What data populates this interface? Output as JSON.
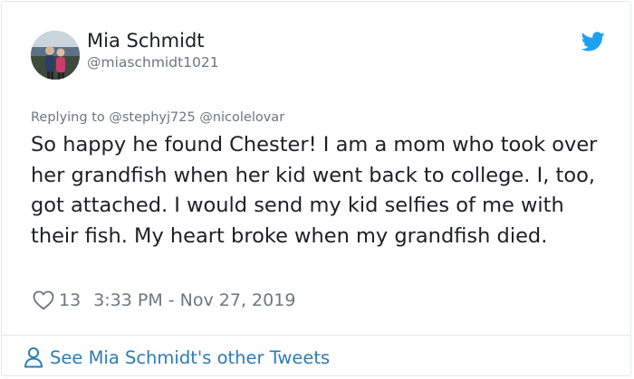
{
  "user": {
    "display_name": "Mia Schmidt",
    "handle": "@miaschmidt1021"
  },
  "reply": {
    "prefix": "Replying to ",
    "mentions": [
      "@stephyj725",
      "@nicolelovar"
    ]
  },
  "tweet": {
    "text": "So happy he found Chester! I am a mom who took over her grandfish when her kid went back to college. I, too, got attached. I would send my kid selfies of me with their fish. My heart broke when my grandfish died.",
    "likes": "13",
    "timestamp": "3:33 PM - Nov 27, 2019"
  },
  "footer": {
    "link_label": "See Mia Schmidt's other Tweets"
  },
  "icons": {
    "brand": "twitter-bird-icon",
    "like": "heart-outline-icon",
    "profile": "person-outline-icon"
  },
  "colors": {
    "brand": "#1da1f2",
    "link": "#2b7bb9",
    "muted": "#697882",
    "text": "#1c2022",
    "border": "#e1e8ed"
  }
}
